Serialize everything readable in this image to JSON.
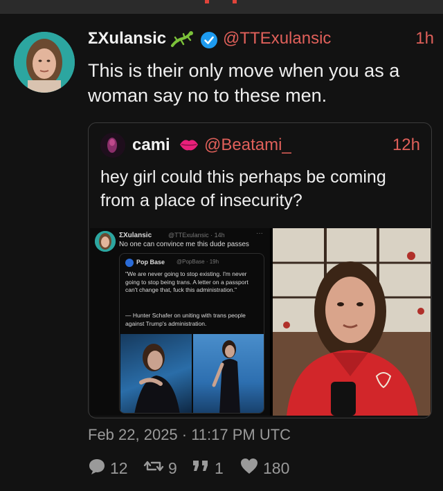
{
  "post": {
    "author_name": "ΣXulansic",
    "author_handle": "@TTExulansic",
    "time": "1h",
    "body_line1": "This is their only move when you as a",
    "body_line2": "woman say no to these men.",
    "date": "Feb 22, 2025 · 11:17 PM UTC"
  },
  "quoted": {
    "author_name": "cami",
    "author_handle": "@Beatami_",
    "time": "12h",
    "text_line1": "hey girl could this perhaps be coming",
    "text_line2": "from a place of insecurity?"
  },
  "screenshot": {
    "author_name": "ΣXulansic",
    "author_meta": "@TTExulansic · 14h",
    "menu": "···",
    "text": "No one can convince me this dude passes",
    "inner_name": "Pop Base",
    "inner_meta": "@PopBase · 19h",
    "inner_quote": "\"We are never going to stop existing. I'm never going to stop being trans. A letter on a passport can't change that, fuck this administration.\"",
    "inner_attribution": "— Hunter Schafer on uniting with trans people against Trump's administration."
  },
  "stats": {
    "replies": "12",
    "retweets": "9",
    "quotes": "1",
    "likes": "180"
  },
  "colors": {
    "background": "#121212",
    "accent": "#e0605a",
    "verified": "#1d9bf0",
    "muted": "#9a9a9a",
    "lips": "#e8207a"
  },
  "icons": [
    "lizard-icon",
    "verified-badge-icon",
    "lips-icon",
    "reply-icon",
    "retweet-icon",
    "quote-icon",
    "heart-icon"
  ]
}
